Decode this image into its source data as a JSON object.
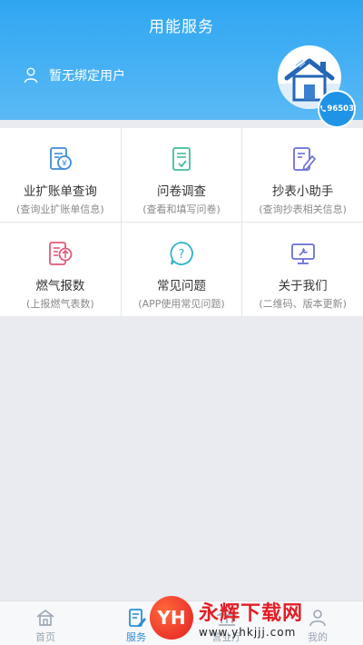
{
  "header": {
    "title": "用能服务",
    "user_label": "暂无绑定用户",
    "hotline": "96503"
  },
  "services": [
    {
      "title": "业扩账单查询",
      "subtitle": "(查询业扩账单信息)",
      "icon": "bill-icon",
      "color": "#3d8bd9"
    },
    {
      "title": "问卷调查",
      "subtitle": "(查看和填写问卷)",
      "icon": "survey-icon",
      "color": "#3fbf9a"
    },
    {
      "title": "抄表小助手",
      "subtitle": "(查询抄表相关信息)",
      "icon": "meter-reading-icon",
      "color": "#6b6fd6"
    },
    {
      "title": "燃气报数",
      "subtitle": "(上报燃气表数)",
      "icon": "gas-report-icon",
      "color": "#e05a78"
    },
    {
      "title": "常见问题",
      "subtitle": "(APP使用常见问题)",
      "icon": "faq-icon",
      "color": "#2bb3c9"
    },
    {
      "title": "关于我们",
      "subtitle": "(二维码、版本更新)",
      "icon": "about-icon",
      "color": "#6b6fd6"
    }
  ],
  "tabs": [
    {
      "label": "首页",
      "icon": "home-icon",
      "active": false
    },
    {
      "label": "服务",
      "icon": "service-icon",
      "active": true
    },
    {
      "label": "营业厅",
      "icon": "hall-icon",
      "active": false
    },
    {
      "label": "我的",
      "icon": "profile-icon",
      "active": false
    }
  ],
  "watermark": {
    "logo_text": "YH",
    "name": "永辉下载网",
    "url": "www.yhkjjj.com"
  }
}
